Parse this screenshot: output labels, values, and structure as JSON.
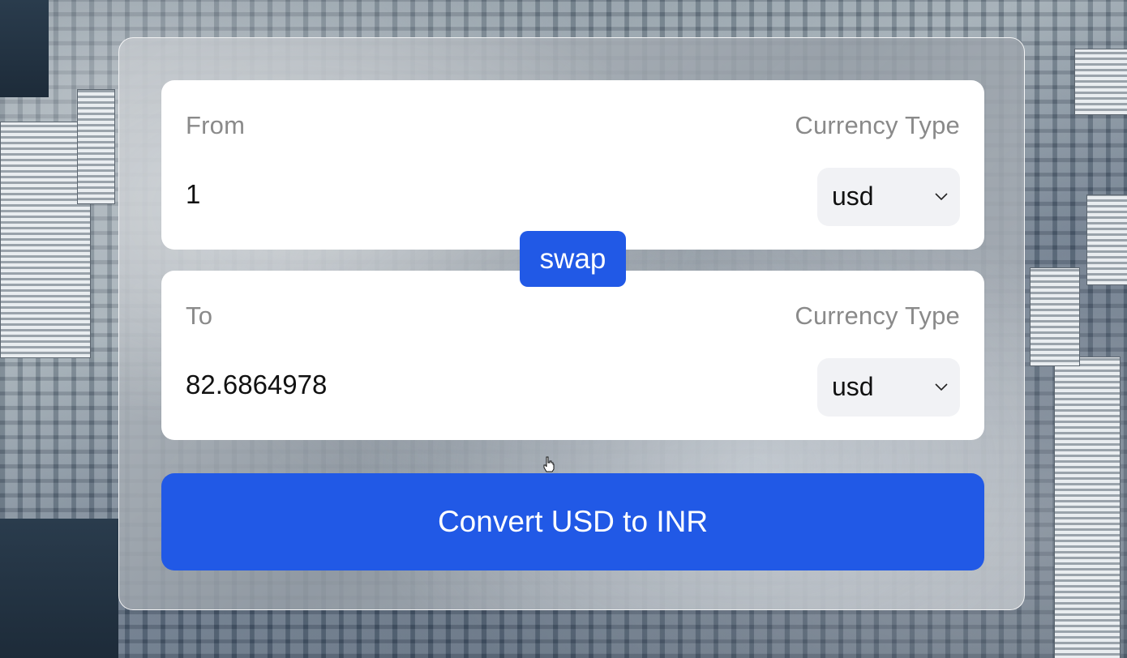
{
  "from": {
    "label": "From",
    "currency_type_label": "Currency Type",
    "amount": "1",
    "currency": "usd"
  },
  "swap_button_label": "swap",
  "to": {
    "label": "To",
    "currency_type_label": "Currency Type",
    "amount": "82.6864978",
    "currency": "usd"
  },
  "convert_button_label": "Convert USD to INR",
  "colors": {
    "accent": "#2159e6",
    "card": "#ffffff",
    "label": "#8a8a8a",
    "select_bg": "#f1f2f5"
  },
  "icons": {
    "select_chevron": "chevron-down-icon",
    "cursor": "hand-pointer-icon"
  }
}
